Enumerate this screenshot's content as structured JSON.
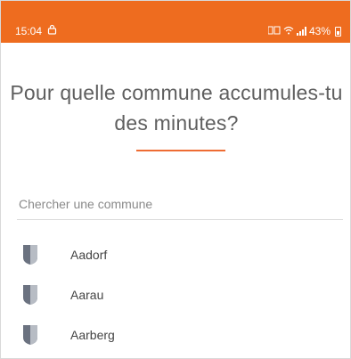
{
  "status_bar": {
    "time": "15:04",
    "signal_text": "⁴⁶",
    "battery_percent": "43%",
    "background": "#ee6c1f"
  },
  "header": {
    "title": "Pour quelle commune accumules-tu des minutes?",
    "accent_color": "#ee6c33"
  },
  "search": {
    "placeholder": "Chercher une commune",
    "value": ""
  },
  "communes": [
    {
      "name": "Aadorf",
      "icon": "shield-icon"
    },
    {
      "name": "Aarau",
      "icon": "shield-icon"
    },
    {
      "name": "Aarberg",
      "icon": "shield-icon"
    }
  ]
}
